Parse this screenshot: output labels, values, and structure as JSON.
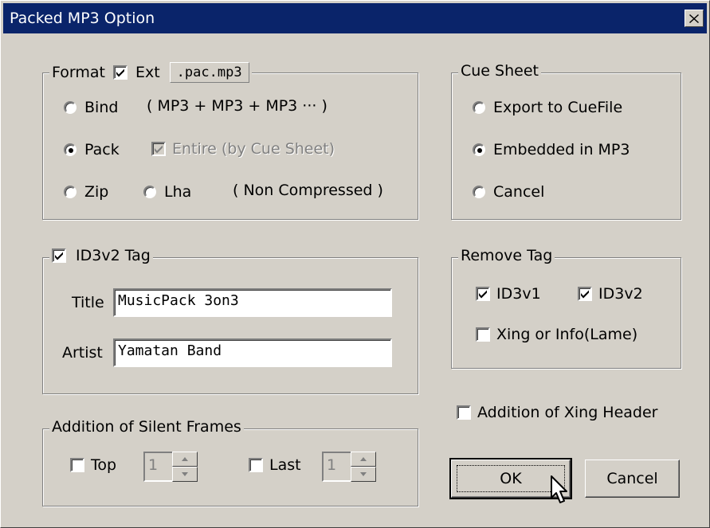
{
  "window": {
    "title": "Packed MP3 Option",
    "close_label": "×"
  },
  "format": {
    "legend": "Format",
    "ext_label": "Ext",
    "ext_checked": true,
    "ext_value": ".pac.mp3",
    "bind_label": "Bind",
    "bind_desc": "( MP3 + MP3 + MP3 ··· )",
    "pack_label": "Pack",
    "entire_label": "Entire (by Cue Sheet)",
    "zip_label": "Zip",
    "lha_label": "Lha",
    "non_compressed": "( Non Compressed )",
    "selected": "Pack"
  },
  "cue_sheet": {
    "legend": "Cue Sheet",
    "options": [
      "Export to CueFile",
      "Embedded in MP3",
      "Cancel"
    ],
    "selected": "Embedded in MP3"
  },
  "id3v2": {
    "legend": "ID3v2 Tag",
    "checked": true,
    "title_label": "Title",
    "title_value": "MusicPack 3on3",
    "artist_label": "Artist",
    "artist_value": "Yamatan Band"
  },
  "remove_tag": {
    "legend": "Remove Tag",
    "id3v1_label": "ID3v1",
    "id3v2_label": "ID3v2",
    "xing_label": "Xing or Info(Lame)"
  },
  "xing_header": {
    "label": "Addition of Xing Header"
  },
  "silent_frames": {
    "legend": "Addition of Silent Frames",
    "top_label": "Top",
    "top_value": "1",
    "last_label": "Last",
    "last_value": "1"
  },
  "buttons": {
    "ok": "OK",
    "cancel": "Cancel"
  },
  "colors": {
    "titlebar": "#0a246a",
    "face": "#d4d0c8"
  }
}
